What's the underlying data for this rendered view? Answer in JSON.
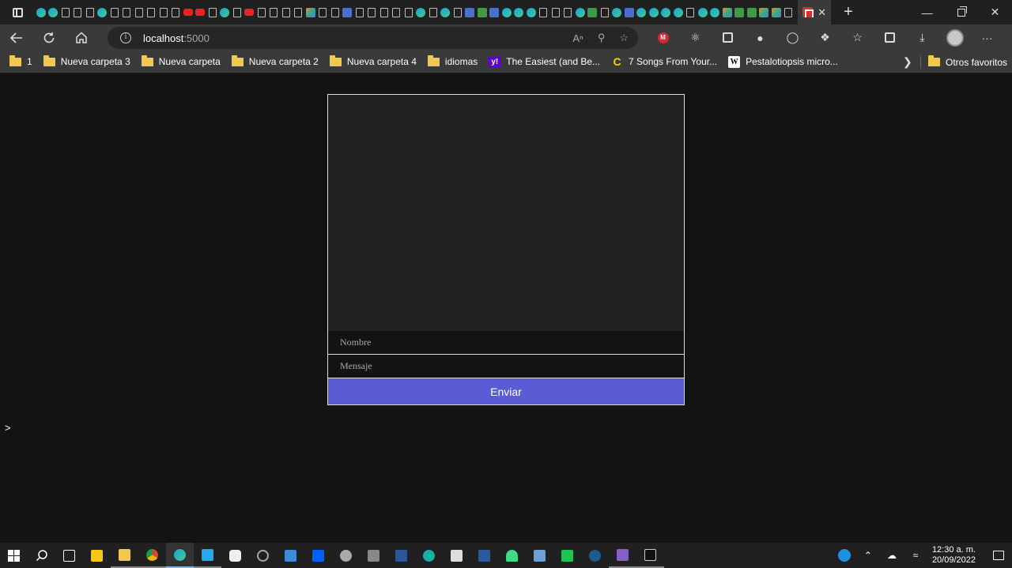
{
  "browser": {
    "url_host": "localhost",
    "url_port": ":5000",
    "active_tab_close": "✕",
    "new_tab": "+"
  },
  "bookmarks": [
    {
      "label": "1",
      "icon": "folder-icon"
    },
    {
      "label": "Nueva carpeta 3",
      "icon": "folder-icon"
    },
    {
      "label": "Nueva carpeta",
      "icon": "folder-icon"
    },
    {
      "label": "Nueva carpeta 2",
      "icon": "folder-icon"
    },
    {
      "label": "Nueva carpeta 4",
      "icon": "folder-icon"
    },
    {
      "label": "idiomas",
      "icon": "folder-icon"
    },
    {
      "label": "The Easiest (and Be...",
      "icon": "yahoo-icon"
    },
    {
      "label": "7 Songs From Your...",
      "icon": "coin-icon"
    },
    {
      "label": "Pestalotiopsis micro...",
      "icon": "wikipedia-icon"
    }
  ],
  "other_favorites": "Otros favoritos",
  "chat": {
    "name_placeholder": "Nombre",
    "message_placeholder": "Mensaje",
    "send_label": "Enviar"
  },
  "prompt_text": ">",
  "taskbar": {
    "time": "12:30 a. m.",
    "date": "20/09/2022"
  },
  "colors": {
    "send_button": "#5b5bd6",
    "page_background": "#131313",
    "messages_background": "#222222"
  }
}
